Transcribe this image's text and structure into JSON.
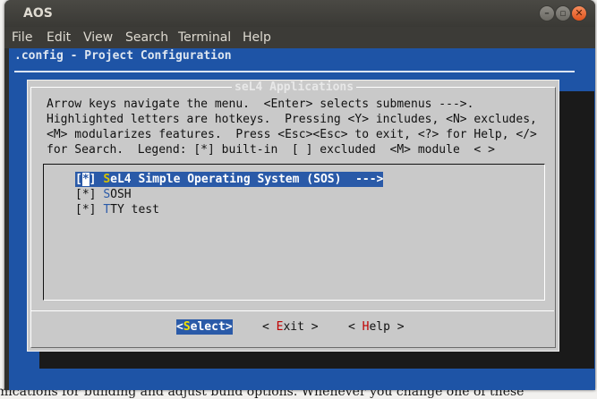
{
  "window": {
    "title": "AOS"
  },
  "menu": [
    "File",
    "Edit",
    "View",
    "Search",
    "Terminal",
    "Help"
  ],
  "terminal": {
    "header": ".config - Project Configuration",
    "dialog_title": "seL4 Applications",
    "help_lines": [
      "Arrow keys navigate the menu.  <Enter> selects submenus --->.",
      "Highlighted letters are hotkeys.  Pressing <Y> includes, <N> excludes,",
      "<M> modularizes features.  Press <Esc><Esc> to exit, <?> for Help, </>",
      "for Search.  Legend: [*] built-in  [ ] excluded  <M> module  < >"
    ],
    "items": [
      {
        "check": "[*]",
        "hotkey": "S",
        "rest": "eL4 Simple Operating System (SOS)  --->",
        "selected": true
      },
      {
        "check": "[*]",
        "hotkey": "S",
        "rest": "OSH",
        "selected": false
      },
      {
        "check": "[*]",
        "hotkey": "T",
        "rest": "TY test",
        "selected": false
      }
    ],
    "buttons": {
      "select": {
        "pre": "<",
        "hk": "S",
        "post": "elect>"
      },
      "exit": {
        "pre": "< ",
        "hk": "E",
        "post": "xit >"
      },
      "help": {
        "pre": "< ",
        "hk": "H",
        "post": "elp >"
      }
    }
  }
}
